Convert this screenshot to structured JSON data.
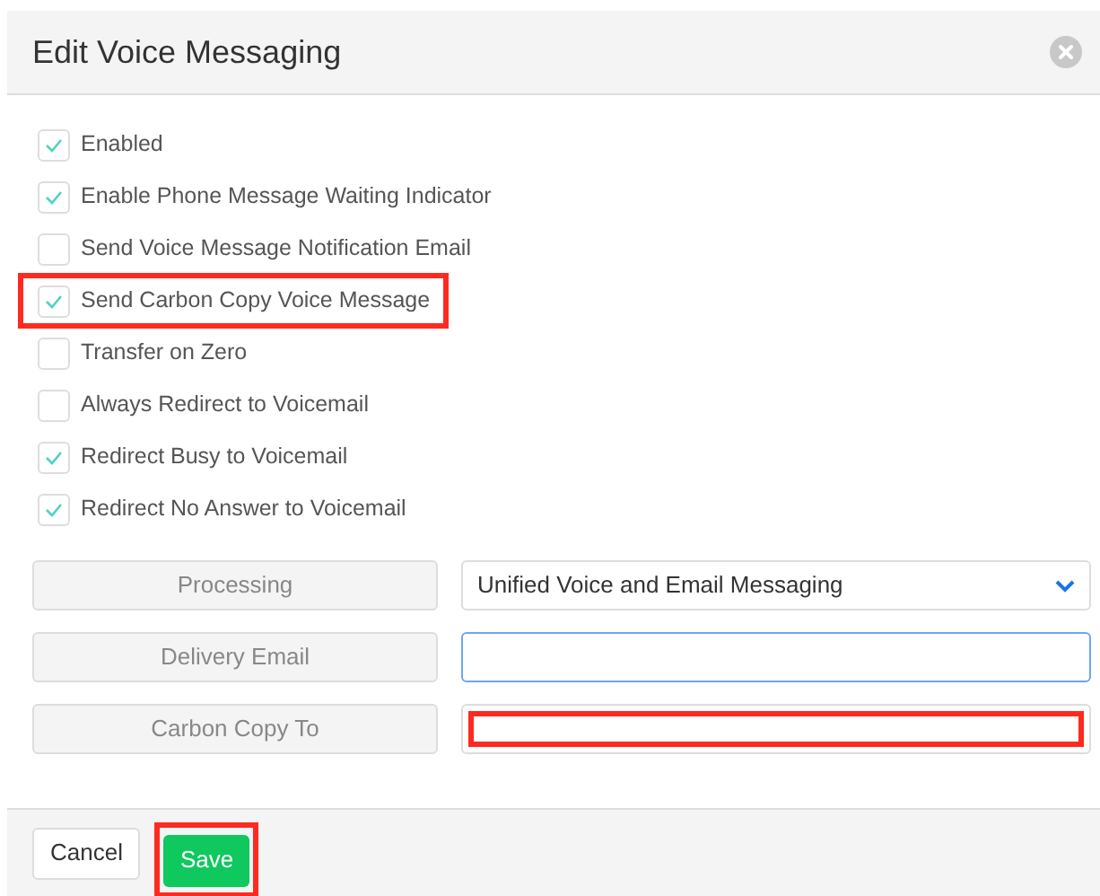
{
  "dialog": {
    "title": "Edit Voice Messaging"
  },
  "options": [
    {
      "label": "Enabled",
      "checked": true,
      "highlighted": false
    },
    {
      "label": "Enable Phone Message Waiting Indicator",
      "checked": true,
      "highlighted": false
    },
    {
      "label": "Send Voice Message Notification Email",
      "checked": false,
      "highlighted": false
    },
    {
      "label": "Send Carbon Copy Voice Message",
      "checked": true,
      "highlighted": true
    },
    {
      "label": "Transfer on Zero",
      "checked": false,
      "highlighted": false
    },
    {
      "label": "Always Redirect to Voicemail",
      "checked": false,
      "highlighted": false
    },
    {
      "label": "Redirect Busy to Voicemail",
      "checked": true,
      "highlighted": false
    },
    {
      "label": "Redirect No Answer to Voicemail",
      "checked": true,
      "highlighted": false
    }
  ],
  "fields": [
    {
      "label": "Processing",
      "kind": "select",
      "value": "Unified Voice and Email Messaging",
      "focused": false,
      "highlighted": false
    },
    {
      "label": "Delivery Email",
      "kind": "text",
      "focused": true,
      "highlighted": false
    },
    {
      "label": "Carbon Copy To",
      "kind": "text",
      "focused": false,
      "highlighted": true
    }
  ],
  "buttons": [
    {
      "label": "Cancel",
      "kind": "secondary",
      "highlighted": false
    },
    {
      "label": "Save",
      "kind": "primary",
      "highlighted": true
    }
  ]
}
